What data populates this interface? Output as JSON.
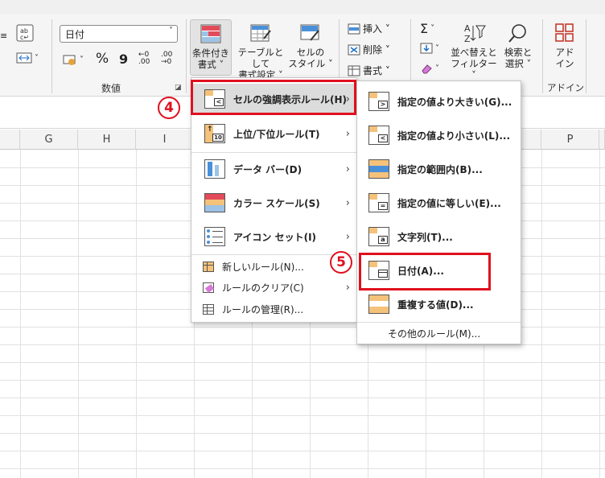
{
  "ribbon": {
    "number_format_value": "日付",
    "number_group_label": "数値",
    "currency_symbol": "%",
    "comma_symbol": "9",
    "cond_format_label_line1": "条件付き",
    "cond_format_label_line2": "書式 ˅",
    "table_format_line1": "テーブルとして",
    "table_format_line2": "書式設定 ˅",
    "cell_style_line1": "セルの",
    "cell_style_line2": "スタイル ˅",
    "insert_label": "挿入 ˅",
    "delete_label": "削除 ˅",
    "format_label": "書式 ˅",
    "sort_filter_line1": "並べ替えと",
    "sort_filter_line2": "フィルター ˅",
    "find_select_line1": "検索と",
    "find_select_line2": "選択 ˅",
    "addin_line1": "アド",
    "addin_line2": "イン",
    "addin_group_label": "アドイン"
  },
  "columns": [
    "G",
    "H",
    "I",
    "P"
  ],
  "main_menu": {
    "items": [
      {
        "label": "セルの強調表示ルール(H)",
        "has_sub": true
      },
      {
        "label": "上位/下位ルール(T)",
        "has_sub": true
      },
      {
        "label": "データ バー(D)",
        "has_sub": true
      },
      {
        "label": "カラー スケール(S)",
        "has_sub": true
      },
      {
        "label": "アイコン セット(I)",
        "has_sub": true
      }
    ],
    "small_items": [
      {
        "label": "新しいルール(N)..."
      },
      {
        "label": "ルールのクリア(C)",
        "has_sub": true
      },
      {
        "label": "ルールの管理(R)..."
      }
    ]
  },
  "sub_menu": {
    "items": [
      {
        "label": "指定の値より大きい(G)..."
      },
      {
        "label": "指定の値より小さい(L)..."
      },
      {
        "label": "指定の範囲内(B)..."
      },
      {
        "label": "指定の値に等しい(E)..."
      },
      {
        "label": "文字列(T)..."
      },
      {
        "label": "日付(A)..."
      },
      {
        "label": "重複する値(D)..."
      }
    ],
    "more_rules": "その他のルール(M)..."
  },
  "callouts": {
    "step4": "4",
    "step5": "5"
  },
  "colors": {
    "highlight": "#e0101e",
    "accent_orange": "#f5c27a",
    "accent_blue": "#4a90d9"
  }
}
